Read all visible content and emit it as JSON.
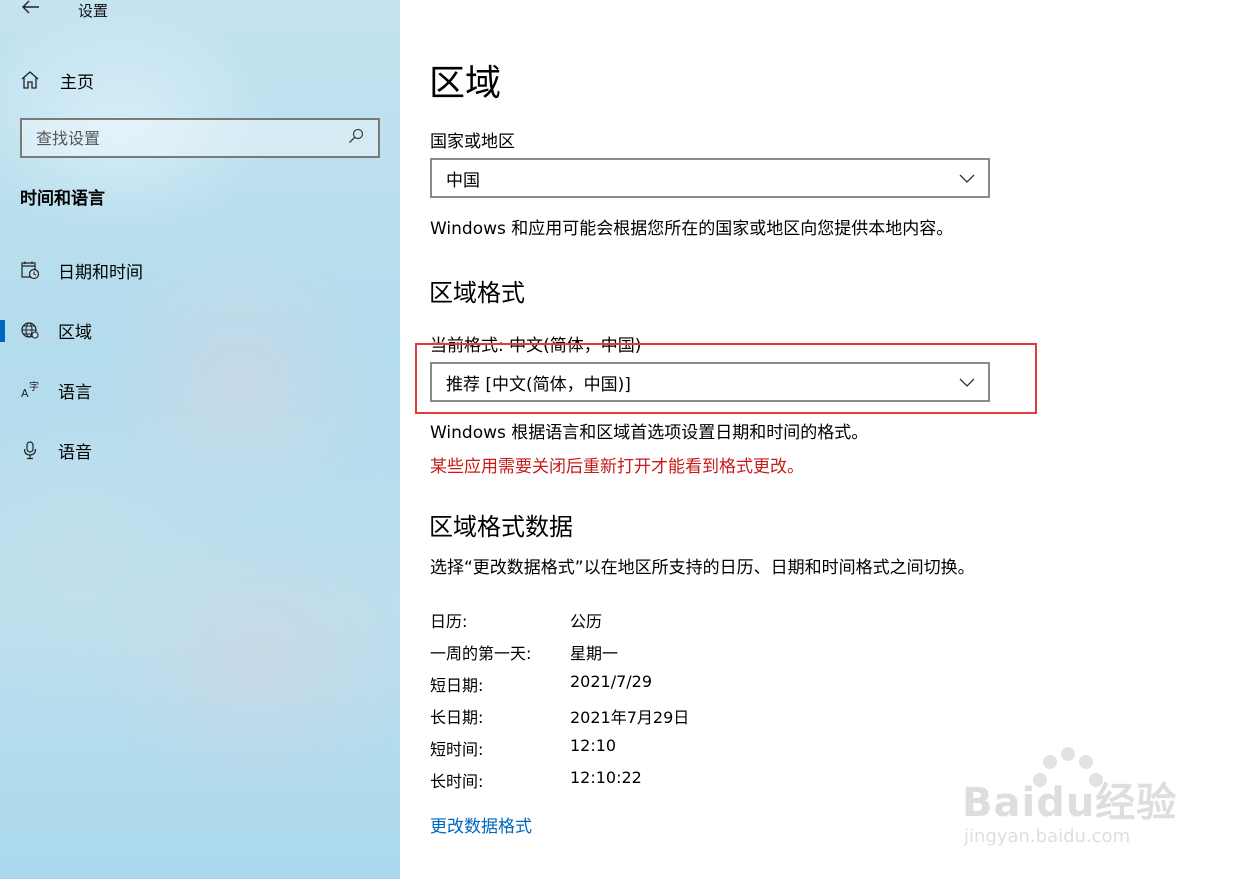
{
  "app": {
    "title": "设置"
  },
  "sidebar": {
    "home_label": "主页",
    "search_placeholder": "查找设置",
    "section_title": "时间和语言",
    "items": [
      {
        "label": "日期和时间",
        "icon": "calendar-clock-icon",
        "selected": false
      },
      {
        "label": "区域",
        "icon": "globe-region-icon",
        "selected": true
      },
      {
        "label": "语言",
        "icon": "language-icon",
        "selected": false
      },
      {
        "label": "语音",
        "icon": "microphone-icon",
        "selected": false
      }
    ]
  },
  "main": {
    "title": "区域",
    "country": {
      "label": "国家或地区",
      "value": "中国",
      "description": "Windows 和应用可能会根据您所在的国家或地区向您提供本地内容。"
    },
    "format": {
      "heading": "区域格式",
      "current_label": "当前格式: 中文(简体，中国)",
      "dropdown_value": "推荐 [中文(简体，中国)]",
      "description": "Windows 根据语言和区域首选项设置日期和时间的格式。",
      "warning": "某些应用需要关闭后重新打开才能看到格式更改。"
    },
    "format_data": {
      "heading": "区域格式数据",
      "description": "选择“更改数据格式”以在地区所支持的日历、日期和时间格式之间切换。",
      "rows": [
        {
          "key": "日历:",
          "value": "公历"
        },
        {
          "key": "一周的第一天:",
          "value": "星期一"
        },
        {
          "key": "短日期:",
          "value": "2021/7/29"
        },
        {
          "key": "长日期:",
          "value": "2021年7月29日"
        },
        {
          "key": "短时间:",
          "value": "12:10"
        },
        {
          "key": "长时间:",
          "value": "12:10:22"
        }
      ],
      "link": "更改数据格式"
    }
  },
  "watermark": {
    "brand": "Baidu经验",
    "url": "jingyan.baidu.com"
  },
  "colors": {
    "accent": "#0067c0",
    "warning": "#c81b1b",
    "highlight_box": "#e03c3c"
  }
}
